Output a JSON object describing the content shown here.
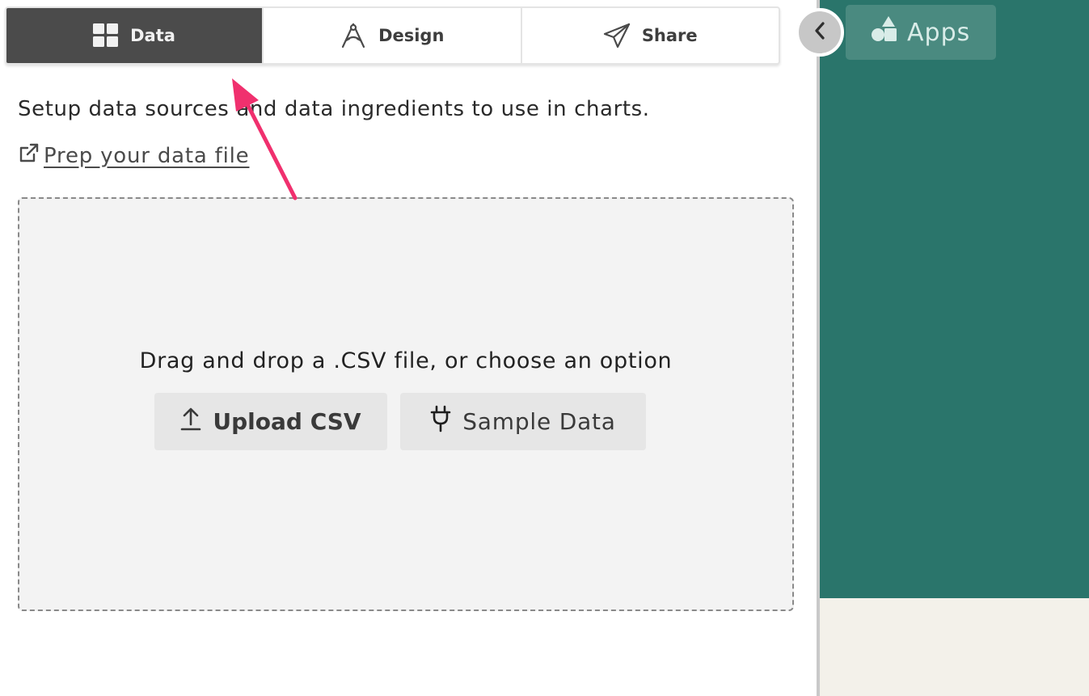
{
  "tabs": [
    {
      "label": "Data",
      "icon": "grid-icon",
      "active": true
    },
    {
      "label": "Design",
      "icon": "compass-icon",
      "active": false
    },
    {
      "label": "Share",
      "icon": "paper-plane-icon",
      "active": false
    }
  ],
  "intro": {
    "text": "Setup data sources and data ingredients to use in charts.",
    "link_label": " Prep your data file",
    "link_icon": "external-link-icon"
  },
  "dropzone": {
    "text": "Drag and drop a .CSV file, or choose an option",
    "upload_label": "Upload CSV",
    "upload_icon": "upload-icon",
    "sample_label": "Sample Data",
    "sample_icon": "plug-icon"
  },
  "sidebar": {
    "apps_label": "Apps",
    "apps_icon": "shapes-icon",
    "collapse_icon": "chevron-left-icon"
  },
  "colors": {
    "active_tab": "#4b4b4b",
    "sidebar_bg": "#2a756b",
    "apps_button_bg": "#4a8a80",
    "annotation_arrow": "#f0306e"
  }
}
